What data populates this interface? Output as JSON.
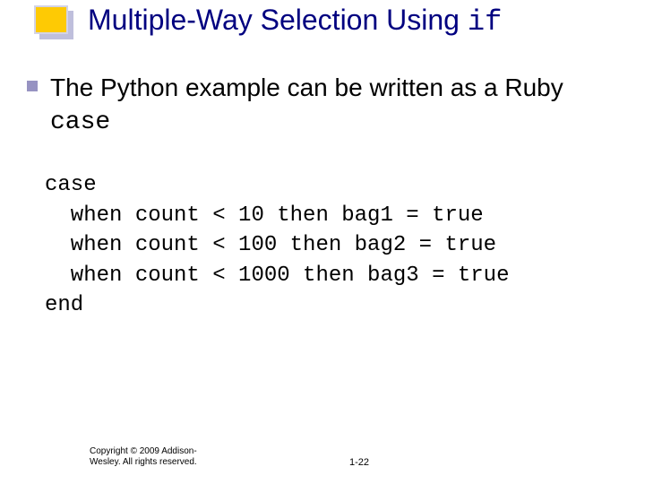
{
  "title": {
    "prefix": "Multiple-Way Selection Using ",
    "code": "if"
  },
  "bullet": {
    "prefix": "The Python example can be written as a Ruby ",
    "code": "case"
  },
  "code": {
    "l0": "case",
    "l1": "  when count < 10 then bag1 = true",
    "l2": "  when count < 100 then bag2 = true",
    "l3": "  when count < 1000 then bag3 = true",
    "l4": "end"
  },
  "footer": {
    "copyright_line1": "Copyright © 2009 Addison-",
    "copyright_line2": "Wesley. All rights reserved.",
    "page": "1-22"
  }
}
